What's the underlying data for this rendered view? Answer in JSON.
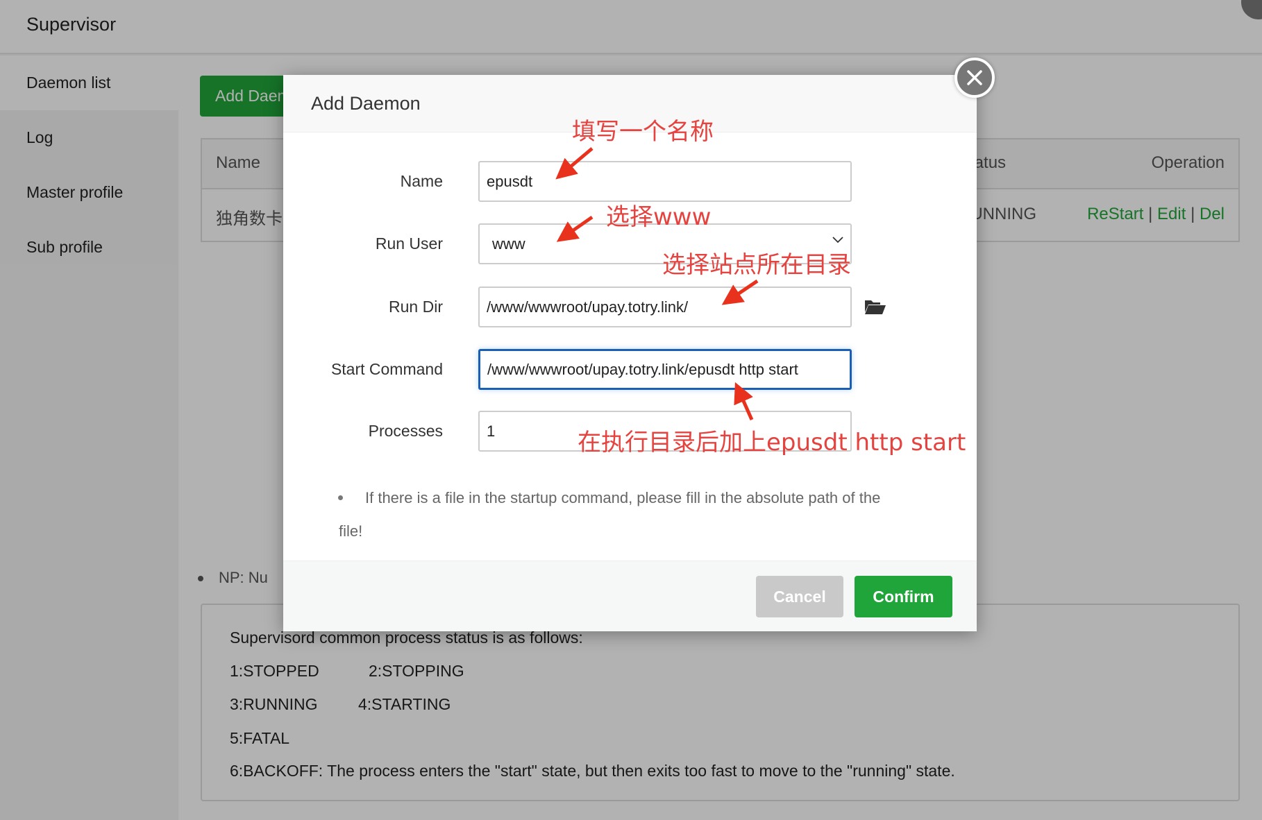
{
  "app": {
    "title": "Supervisor"
  },
  "sidebar": {
    "items": [
      {
        "label": "Daemon list",
        "active": true
      },
      {
        "label": "Log",
        "active": false
      },
      {
        "label": "Master profile",
        "active": false
      },
      {
        "label": "Sub profile",
        "active": false
      }
    ]
  },
  "toolbar": {
    "add_label": "Add Daemon"
  },
  "table": {
    "headers": {
      "name": "Name",
      "status": "Status",
      "operation": "Operation"
    },
    "rows": [
      {
        "name": "独角数卡",
        "status": "RUNNING",
        "ops": [
          "ReStart",
          "Edit",
          "Del"
        ],
        "separator": "|"
      }
    ]
  },
  "notes": {
    "np": "NP: Nu",
    "status_box": {
      "title": "Supervisord common process status is as follows:",
      "lines": [
        [
          "1:STOPPED",
          "2:STOPPING"
        ],
        [
          "3:RUNNING",
          "4:STARTING"
        ],
        [
          "5:FATAL"
        ],
        [
          "6:BACKOFF: The process enters the \"start\" state, but then exits too fast to move to the \"running\" state."
        ]
      ]
    }
  },
  "modal": {
    "title": "Add Daemon",
    "fields": {
      "name": {
        "label": "Name",
        "value": "epusdt"
      },
      "run_user": {
        "label": "Run User",
        "value": "www",
        "options": [
          "www"
        ]
      },
      "run_dir": {
        "label": "Run Dir",
        "value": "/www/wwwroot/upay.totry.link/"
      },
      "start_command": {
        "label": "Start Command",
        "value": "/www/wwwroot/upay.totry.link/epusdt http start"
      },
      "processes": {
        "label": "Processes",
        "value": "1"
      }
    },
    "note_line1": "If there is a file in the startup command, please fill in the absolute path of the",
    "note_line2": "file!",
    "cancel_label": "Cancel",
    "confirm_label": "Confirm"
  },
  "annotations": {
    "name": "填写一个名称",
    "run_user": "选择www",
    "run_dir": "选择站点所在目录",
    "start_command": "在执行目录后加上epusdt http start"
  },
  "colors": {
    "accent_green": "#20a53a",
    "annotation_red": "#e5433f",
    "focus_blue": "#1a5fb4",
    "cancel_gray": "#c9c9c9"
  }
}
